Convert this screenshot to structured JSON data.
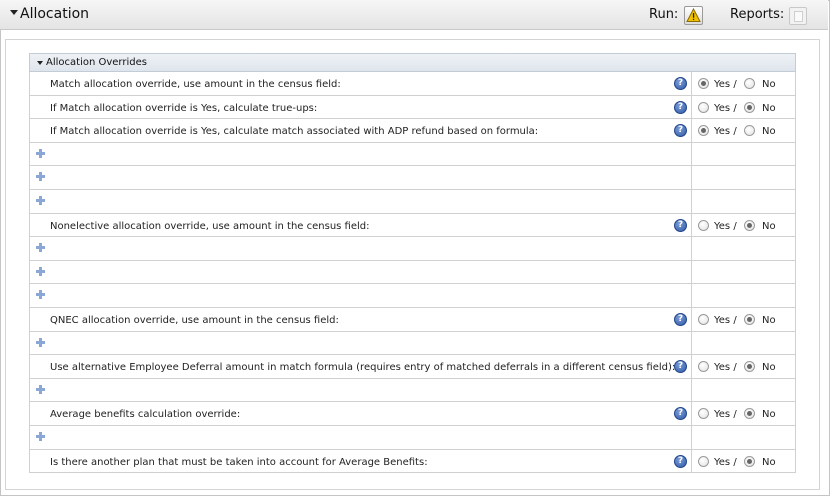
{
  "header": {
    "title": "Allocation",
    "run_label": "Run:",
    "reports_label": "Reports:"
  },
  "section": {
    "title": "Allocation Overrides"
  },
  "options": {
    "yes": "Yes /",
    "no": "No"
  },
  "help_glyph": "?",
  "rows": [
    {
      "type": "question",
      "text": "Match allocation override, use amount in the census field:",
      "selected": "yes"
    },
    {
      "type": "question",
      "text": "If Match allocation override is Yes, calculate true-ups:",
      "selected": "no"
    },
    {
      "type": "question",
      "text": "If Match allocation override is Yes, calculate match associated with ADP refund based on formula:",
      "selected": "yes"
    },
    {
      "type": "add"
    },
    {
      "type": "add"
    },
    {
      "type": "add"
    },
    {
      "type": "question",
      "text": "Nonelective allocation override, use amount in the census field:",
      "selected": "no"
    },
    {
      "type": "add"
    },
    {
      "type": "add"
    },
    {
      "type": "add"
    },
    {
      "type": "question",
      "text": "QNEC allocation override, use amount in the census field:",
      "selected": "no"
    },
    {
      "type": "add"
    },
    {
      "type": "question",
      "text": "Use alternative Employee Deferral amount in match formula (requires entry of matched deferrals in a different census field):",
      "selected": "no"
    },
    {
      "type": "add"
    },
    {
      "type": "question",
      "text": "Average benefits calculation override:",
      "selected": "no"
    },
    {
      "type": "add"
    },
    {
      "type": "question",
      "text": "Is there another plan that must be taken into account for Average Benefits:",
      "selected": "no"
    }
  ],
  "colors": {
    "help_icon": "#2d58a8",
    "plus_icon": "#8aa7d6",
    "warning_icon": "#f2c200"
  },
  "icons": {
    "run": "warning-icon",
    "reports": "report-icon",
    "help": "help-icon",
    "add": "plus-icon"
  }
}
